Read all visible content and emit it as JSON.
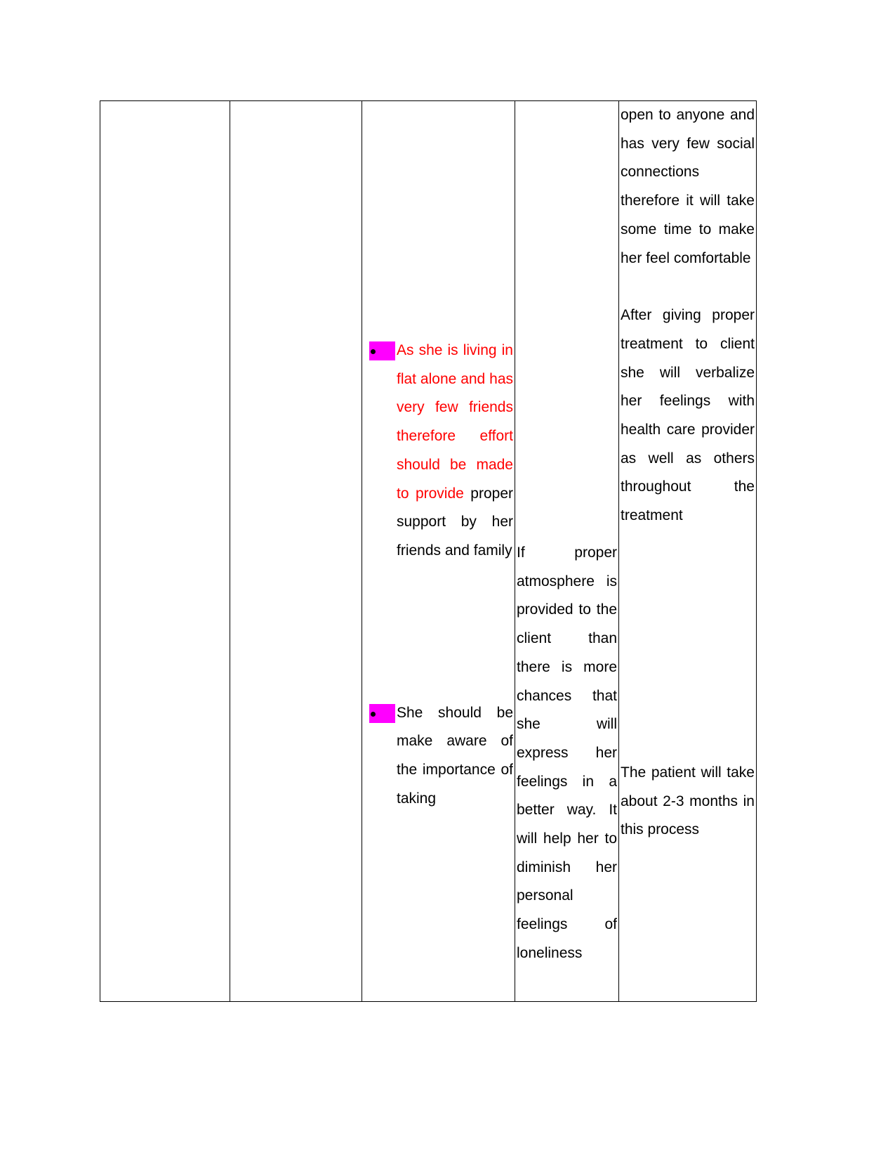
{
  "document": {
    "type": "nursing-care-plan-table",
    "page_background": "#ffffff",
    "text_color": "#000000",
    "highlight_color": "#ff00ff",
    "red_text_color": "#ff0000",
    "border_color": "#000000"
  },
  "table": {
    "column_count": 5,
    "columns": [
      {
        "index": 1,
        "name": "column-one",
        "content": ""
      },
      {
        "index": 2,
        "name": "column-two",
        "content": ""
      },
      {
        "index": 3,
        "name": "nursing-interventions",
        "bullets": [
          {
            "marker": "bullet-highlighted",
            "red_part": "As she is living in flat alone and has very few friends therefore effort should be made to provide",
            "black_part": " proper support by her friends and family"
          },
          {
            "marker": "bullet-highlighted",
            "red_part": "",
            "black_part": "She should be make aware of the importance of taking"
          }
        ]
      },
      {
        "index": 4,
        "name": "rationale",
        "paragraph": "If proper atmosphere is provided to the client than there is more chances that she will express her feelings in a better way. It will help her to diminish her personal feelings of loneliness"
      },
      {
        "index": 5,
        "name": "evaluation",
        "paragraphs": [
          "open to anyone and has very few social connections therefore it will take some time to make her feel comfortable",
          "After giving proper treatment to client she will verbalize her feelings with health care provider as well as others throughout the treatment",
          "The patient will take about 2-3 months in this process"
        ]
      }
    ]
  }
}
